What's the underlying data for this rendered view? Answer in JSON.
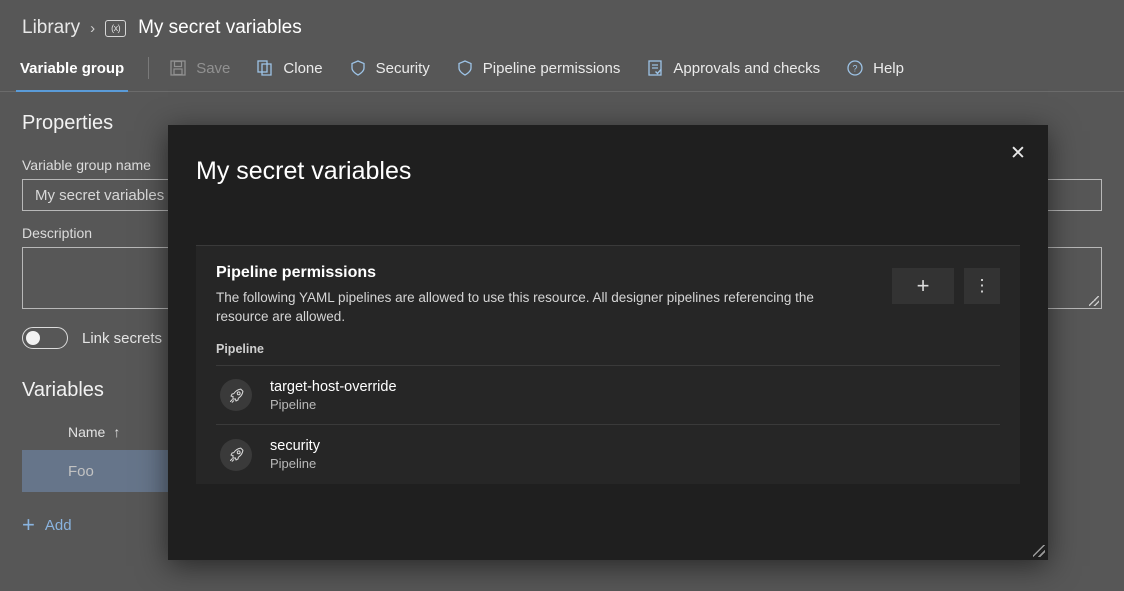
{
  "breadcrumb": {
    "root_label": "Library",
    "separator": "›",
    "icon_text": "(x)",
    "current_label": "My secret variables"
  },
  "toolbar": {
    "tab_label": "Variable group",
    "items": [
      {
        "label": "Save",
        "icon": "save-icon",
        "disabled": true
      },
      {
        "label": "Clone",
        "icon": "clone-icon",
        "disabled": false
      },
      {
        "label": "Security",
        "icon": "shield-icon",
        "disabled": false
      },
      {
        "label": "Pipeline permissions",
        "icon": "shield-icon",
        "disabled": false
      },
      {
        "label": "Approvals and checks",
        "icon": "checklist-icon",
        "disabled": false
      },
      {
        "label": "Help",
        "icon": "help-circle-icon",
        "disabled": false
      }
    ]
  },
  "properties": {
    "heading": "Properties",
    "name_label": "Variable group name",
    "name_value": "My secret variables",
    "description_label": "Description",
    "description_value": "",
    "link_secrets_label": "Link secrets",
    "link_secrets_on": false
  },
  "variables": {
    "heading": "Variables",
    "column_name": "Name",
    "sort_arrow": "↑",
    "rows": [
      {
        "name": "Foo",
        "selected": true
      }
    ],
    "add_label": "Add",
    "add_icon": "plus-icon"
  },
  "dialog": {
    "title": "My secret variables",
    "close_icon": "close-icon",
    "panel": {
      "title": "Pipeline permissions",
      "description": "The following YAML pipelines are allowed to use this resource. All designer pipelines referencing the resource are allowed.",
      "add_button_label": "+",
      "more_button_label": "⋮",
      "column_header": "Pipeline",
      "rows": [
        {
          "name": "target-host-override",
          "subtitle": "Pipeline",
          "icon": "rocket-icon"
        },
        {
          "name": "security",
          "subtitle": "Pipeline",
          "icon": "rocket-icon"
        }
      ]
    }
  },
  "colors": {
    "page_background": "#575757",
    "dialog_background": "#1f1f1f",
    "panel_background": "#262626",
    "accent_blue": "#5a9bd8",
    "selected_row": "#66758a",
    "link_blue": "#8ab4e0"
  }
}
